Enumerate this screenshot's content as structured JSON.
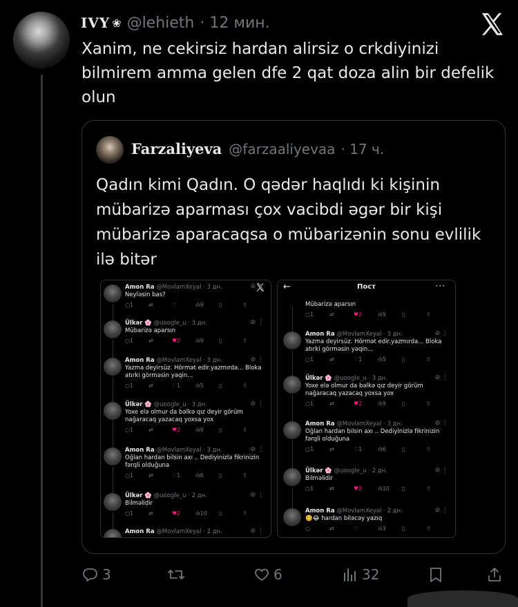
{
  "tweet": {
    "author_name": "IVY",
    "author_badge": "❀",
    "handle": "@lehieth",
    "time": "· 12 мин.",
    "text": "Xanim, ne cekirsiz hardan alirsiz o crkdiyinizi bilmirem amma gelen dfe 2 qat doza alin bir defelik olun",
    "actions": {
      "replies": "3",
      "retweets": "",
      "likes": "6",
      "views": "32"
    }
  },
  "quote": {
    "author_name": "Farzaliyeva",
    "handle": "@farzaaliyevaa",
    "time": "· 17 ч.",
    "text": "Qadın kimi Qadın. O qədər haqlıdı ki kişinin mübarizə aparması çox vacibdi əgər bir kişi mübarizə aparacaqsa o mübarizənin sonu evlilik ilə bitər"
  },
  "screenshot_left": {
    "items": [
      {
        "name": "Amon Ra",
        "handle": "@MovlamXeyal · 3 дн.",
        "text": [
          "Neyləsin bas?"
        ],
        "replies": "1",
        "retweets": "",
        "likes": "",
        "views": "9",
        "liked": false
      },
      {
        "name": "Ülkər 🌸",
        "handle": "@uoogle_u · 3 дн.",
        "text": [
          "Mübarizə aparsın"
        ],
        "replies": "1",
        "retweets": "",
        "likes": "2",
        "views": "9",
        "liked": true
      },
      {
        "name": "Amon Ra",
        "handle": "@MovlamXeyal · 3 дн.",
        "text": [
          "Yazma deyirsüz. Hörmət edir.yazmırda... Bloka",
          "atırki görməsin yəqin..."
        ],
        "replies": "1",
        "retweets": "",
        "likes": "1",
        "views": "5",
        "liked": false
      },
      {
        "name": "Ülkər 🌸",
        "handle": "@uoogle_u · 3 дн.",
        "text": [
          "Yoxe elə olmur da bəlkə qız deyir görüm",
          "nağaracaq yazacaq yoxsa yox"
        ],
        "replies": "1",
        "retweets": "",
        "likes": "2",
        "views": "9",
        "liked": true
      },
      {
        "name": "Amon Ra",
        "handle": "@MovlamXeyal · 3 дн.",
        "text": [
          "Oğlan hardan bilsin axı .. Dediyinizlə fikrinizin",
          "fərqli olduğuna"
        ],
        "replies": "1",
        "retweets": "",
        "likes": "1",
        "views": "6",
        "liked": false
      },
      {
        "name": "Ülkər 🌸",
        "handle": "@uoogle_u · 2 дн.",
        "text": [
          "Bilməlidir"
        ],
        "replies": "1",
        "retweets": "",
        "likes": "2",
        "views": "10",
        "liked": true
      },
      {
        "name": "Amon Ra",
        "handle": "@MovlamXeyal · 2 дн.",
        "text": [],
        "replies": "",
        "retweets": "",
        "likes": "",
        "views": "",
        "liked": false
      }
    ]
  },
  "screenshot_right": {
    "title": "Пост",
    "items": [
      {
        "name": "",
        "handle": "",
        "text": [
          "Mübarizə aparsın"
        ],
        "replies": "1",
        "retweets": "",
        "likes": "2",
        "views": "9",
        "liked": true
      },
      {
        "name": "Amon Ra",
        "handle": "@MovlamXeyal · 3 дн.",
        "text": [
          "Yazma deyirsüz. Hörmət edir.yazmırda... Bloka",
          "atırki görməsin yəqin..."
        ],
        "replies": "1",
        "retweets": "",
        "likes": "1",
        "views": "5",
        "liked": false
      },
      {
        "name": "Ülkər 🌸",
        "handle": "@uoogle_u · 3 дн.",
        "text": [
          "Yoxe elə olmur da bəlkə qız deyir görüm",
          "nağaracaq yazacaq yoxsa yox"
        ],
        "replies": "1",
        "retweets": "",
        "likes": "2",
        "views": "9",
        "liked": true
      },
      {
        "name": "Amon Ra",
        "handle": "@MovlamXeyal · 3 дн.",
        "text": [
          "Oğlan hardan bilsin axı .. Dediyinizlə fikrinizin",
          "fərqli olduğuna"
        ],
        "replies": "1",
        "retweets": "",
        "likes": "1",
        "views": "6",
        "liked": false
      },
      {
        "name": "Ülkər 🌸",
        "handle": "@uoogle_u · 2 дн.",
        "text": [
          "Bilməlidir"
        ],
        "replies": "1",
        "retweets": "",
        "likes": "2",
        "views": "10",
        "liked": true
      },
      {
        "name": "Amon Ra",
        "handle": "@MovlamXeyal · 2 дн.",
        "text": [
          "🥴😂 hardan biləcəy yazıq"
        ],
        "replies": "",
        "retweets": "",
        "likes": "",
        "views": "3",
        "liked": false
      }
    ]
  },
  "colors": {
    "background": "#000000",
    "text": "#e7e9ea",
    "muted": "#71767b",
    "border": "#2f3336",
    "like": "#f91880"
  },
  "icons": [
    "x-logo-icon",
    "reply-icon",
    "retweet-icon",
    "like-icon",
    "views-icon",
    "bookmark-icon",
    "share-icon",
    "back-arrow-icon",
    "more-icon"
  ]
}
